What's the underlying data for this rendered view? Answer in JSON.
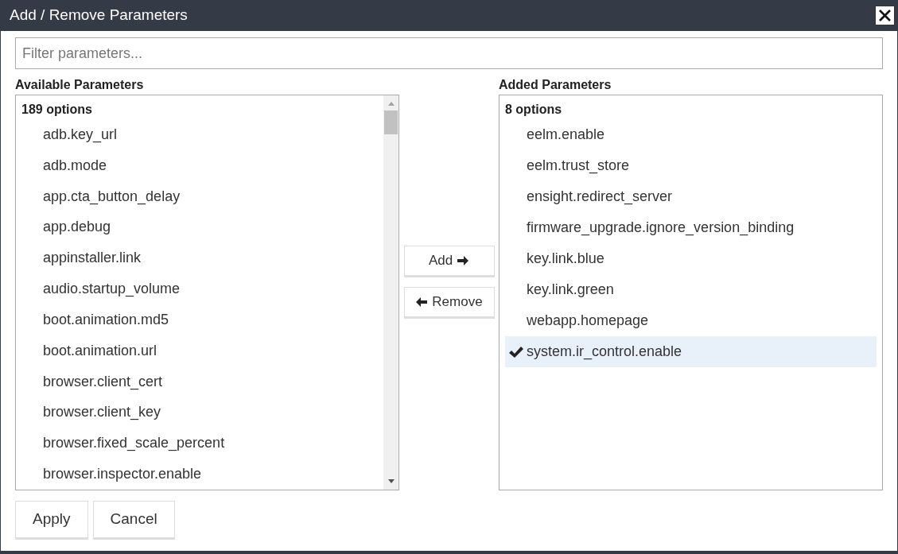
{
  "window": {
    "title": "Add / Remove Parameters"
  },
  "filter": {
    "placeholder": "Filter parameters..."
  },
  "available": {
    "label": "Available Parameters",
    "count": "189 options",
    "items": [
      {
        "label": "adb.key_url",
        "selected": false
      },
      {
        "label": "adb.mode",
        "selected": false
      },
      {
        "label": "app.cta_button_delay",
        "selected": false
      },
      {
        "label": "app.debug",
        "selected": false
      },
      {
        "label": "appinstaller.link",
        "selected": false
      },
      {
        "label": "audio.startup_volume",
        "selected": false
      },
      {
        "label": "boot.animation.md5",
        "selected": false
      },
      {
        "label": "boot.animation.url",
        "selected": false
      },
      {
        "label": "browser.client_cert",
        "selected": false
      },
      {
        "label": "browser.client_key",
        "selected": false
      },
      {
        "label": "browser.fixed_scale_percent",
        "selected": false
      },
      {
        "label": "browser.inspector.enable",
        "selected": false
      }
    ]
  },
  "transfer_buttons": [
    {
      "label": "Add",
      "kind": "add"
    },
    {
      "label": "Remove",
      "kind": "remove"
    }
  ],
  "added": {
    "label": "Added Parameters",
    "count": "8 options",
    "items": [
      {
        "label": "eelm.enable",
        "selected": false
      },
      {
        "label": "eelm.trust_store",
        "selected": false
      },
      {
        "label": "ensight.redirect_server",
        "selected": false
      },
      {
        "label": "firmware_upgrade.ignore_version_binding",
        "selected": false
      },
      {
        "label": "key.link.blue",
        "selected": false
      },
      {
        "label": "key.link.green",
        "selected": false
      },
      {
        "label": "webapp.homepage",
        "selected": false
      },
      {
        "label": "system.ir_control.enable",
        "selected": true
      }
    ]
  },
  "buttons": [
    "Apply",
    "Cancel"
  ]
}
